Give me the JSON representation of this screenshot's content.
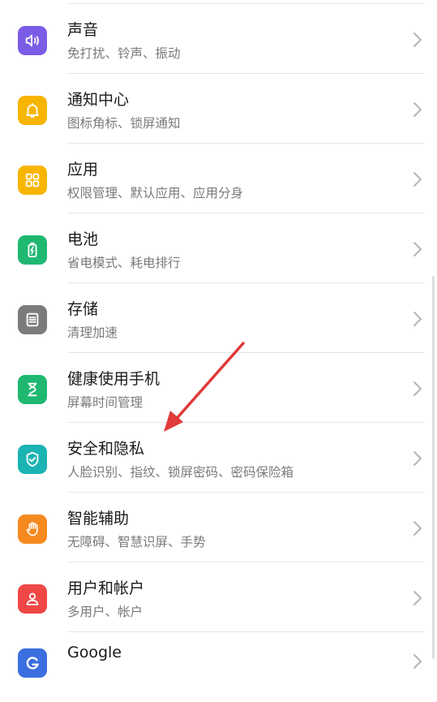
{
  "settings": {
    "items": [
      {
        "title": "声音",
        "subtitle": "免打扰、铃声、振动",
        "icon": "speaker-icon",
        "color": "#7b5ce6"
      },
      {
        "title": "通知中心",
        "subtitle": "图标角标、锁屏通知",
        "icon": "bell-icon",
        "color": "#f7b500"
      },
      {
        "title": "应用",
        "subtitle": "权限管理、默认应用、应用分身",
        "icon": "apps-grid-icon",
        "color": "#f7b500"
      },
      {
        "title": "电池",
        "subtitle": "省电模式、耗电排行",
        "icon": "battery-icon",
        "color": "#1fb871"
      },
      {
        "title": "存储",
        "subtitle": "清理加速",
        "icon": "storage-icon",
        "color": "#7b7b7b"
      },
      {
        "title": "健康使用手机",
        "subtitle": "屏幕时间管理",
        "icon": "hourglass-icon",
        "color": "#1fb871"
      },
      {
        "title": "安全和隐私",
        "subtitle": "人脸识别、指纹、锁屏密码、密码保险箱",
        "icon": "shield-check-icon",
        "color": "#1cb3b3"
      },
      {
        "title": "智能辅助",
        "subtitle": "无障碍、智慧识屏、手势",
        "icon": "hand-icon",
        "color": "#f58a1f"
      },
      {
        "title": "用户和帐户",
        "subtitle": "多用户、帐户",
        "icon": "user-icon",
        "color": "#ef4646"
      },
      {
        "title": "Google",
        "subtitle": "",
        "icon": "google-icon",
        "color": "#3b6fe0"
      }
    ]
  },
  "annotation": {
    "arrow_color": "#e03a3a"
  }
}
